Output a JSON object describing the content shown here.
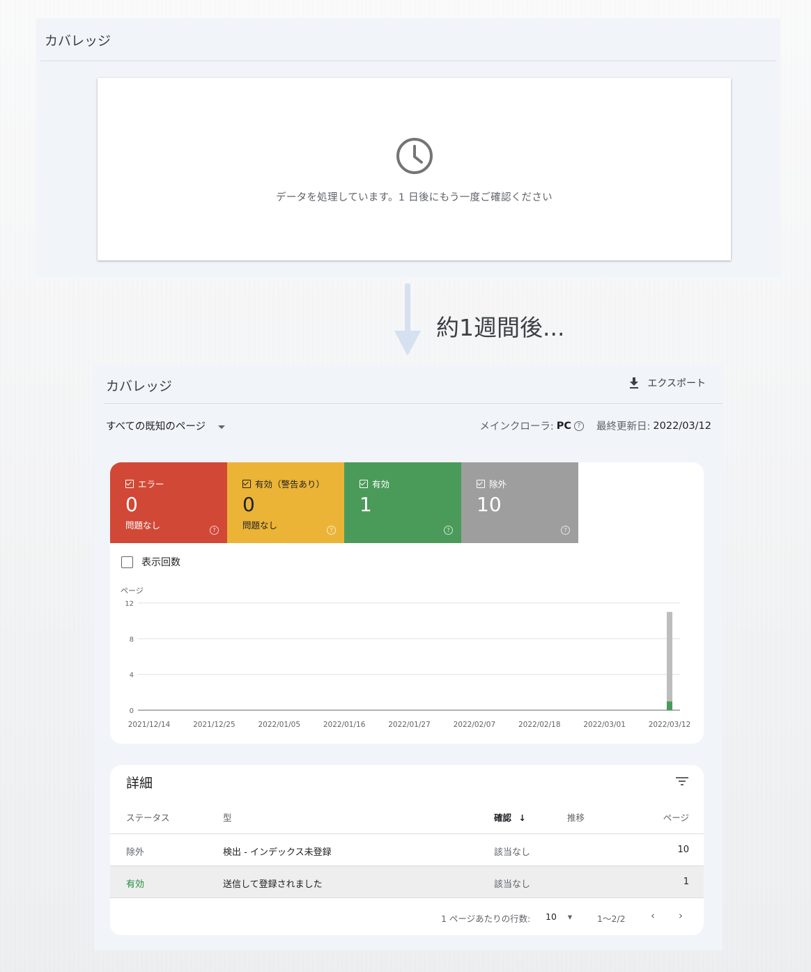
{
  "top_panel": {
    "title": "カバレッジ",
    "processing_message": "データを処理しています。1 日後にもう一度ご確認ください"
  },
  "caption": "約1週間後...",
  "coverage": {
    "title": "カバレッジ",
    "export_label": "エクスポート",
    "page_filter": "すべての既知のページ",
    "crawler_label": "メインクローラ:",
    "crawler_value": "PC",
    "updated_label": "最終更新日:",
    "updated_value": "2022/03/12",
    "tiles": [
      {
        "label": "エラー",
        "count": "0",
        "sub": "問題なし",
        "color": "#d14836"
      },
      {
        "label": "有効（警告あり）",
        "count": "0",
        "sub": "問題なし",
        "color": "#ebb437"
      },
      {
        "label": "有効",
        "count": "1",
        "sub": "",
        "color": "#4a9b5a"
      },
      {
        "label": "除外",
        "count": "10",
        "sub": "",
        "color": "#9e9e9e"
      }
    ],
    "impressions_label": "表示回数",
    "y_axis_label": "ページ"
  },
  "chart_data": {
    "type": "bar",
    "ylabel": "ページ",
    "ylim": [
      0,
      12
    ],
    "yticks": [
      "0",
      "4",
      "8",
      "12"
    ],
    "x_ticks": [
      "2021/12/14",
      "2021/12/25",
      "2022/01/05",
      "2022/01/16",
      "2022/01/27",
      "2022/02/07",
      "2022/02/18",
      "2022/03/01",
      "2022/03/12"
    ],
    "stacked": true,
    "series": [
      {
        "name": "有効",
        "color": "#4a9b5a",
        "points": [
          {
            "x": "2022/03/12",
            "y": 1
          }
        ]
      },
      {
        "name": "除外",
        "color": "#bdbdbd",
        "points": [
          {
            "x": "2022/03/12",
            "y": 10
          }
        ]
      }
    ],
    "grid": true
  },
  "details": {
    "title": "詳細",
    "columns": [
      "ステータス",
      "型",
      "確認",
      "推移",
      "ページ"
    ],
    "rows": [
      {
        "status": "除外",
        "type": "検出 - インデックス未登録",
        "check": "該当なし",
        "pages": "10",
        "status_color": "#5f6368"
      },
      {
        "status": "有効",
        "type": "送信して登録されました",
        "check": "該当なし",
        "pages": "1",
        "status_color": "#1e8e3e"
      }
    ],
    "rows_per_page_label": "1 ページあたりの行数:",
    "rows_per_page_value": "10",
    "range": "1〜2/2"
  }
}
